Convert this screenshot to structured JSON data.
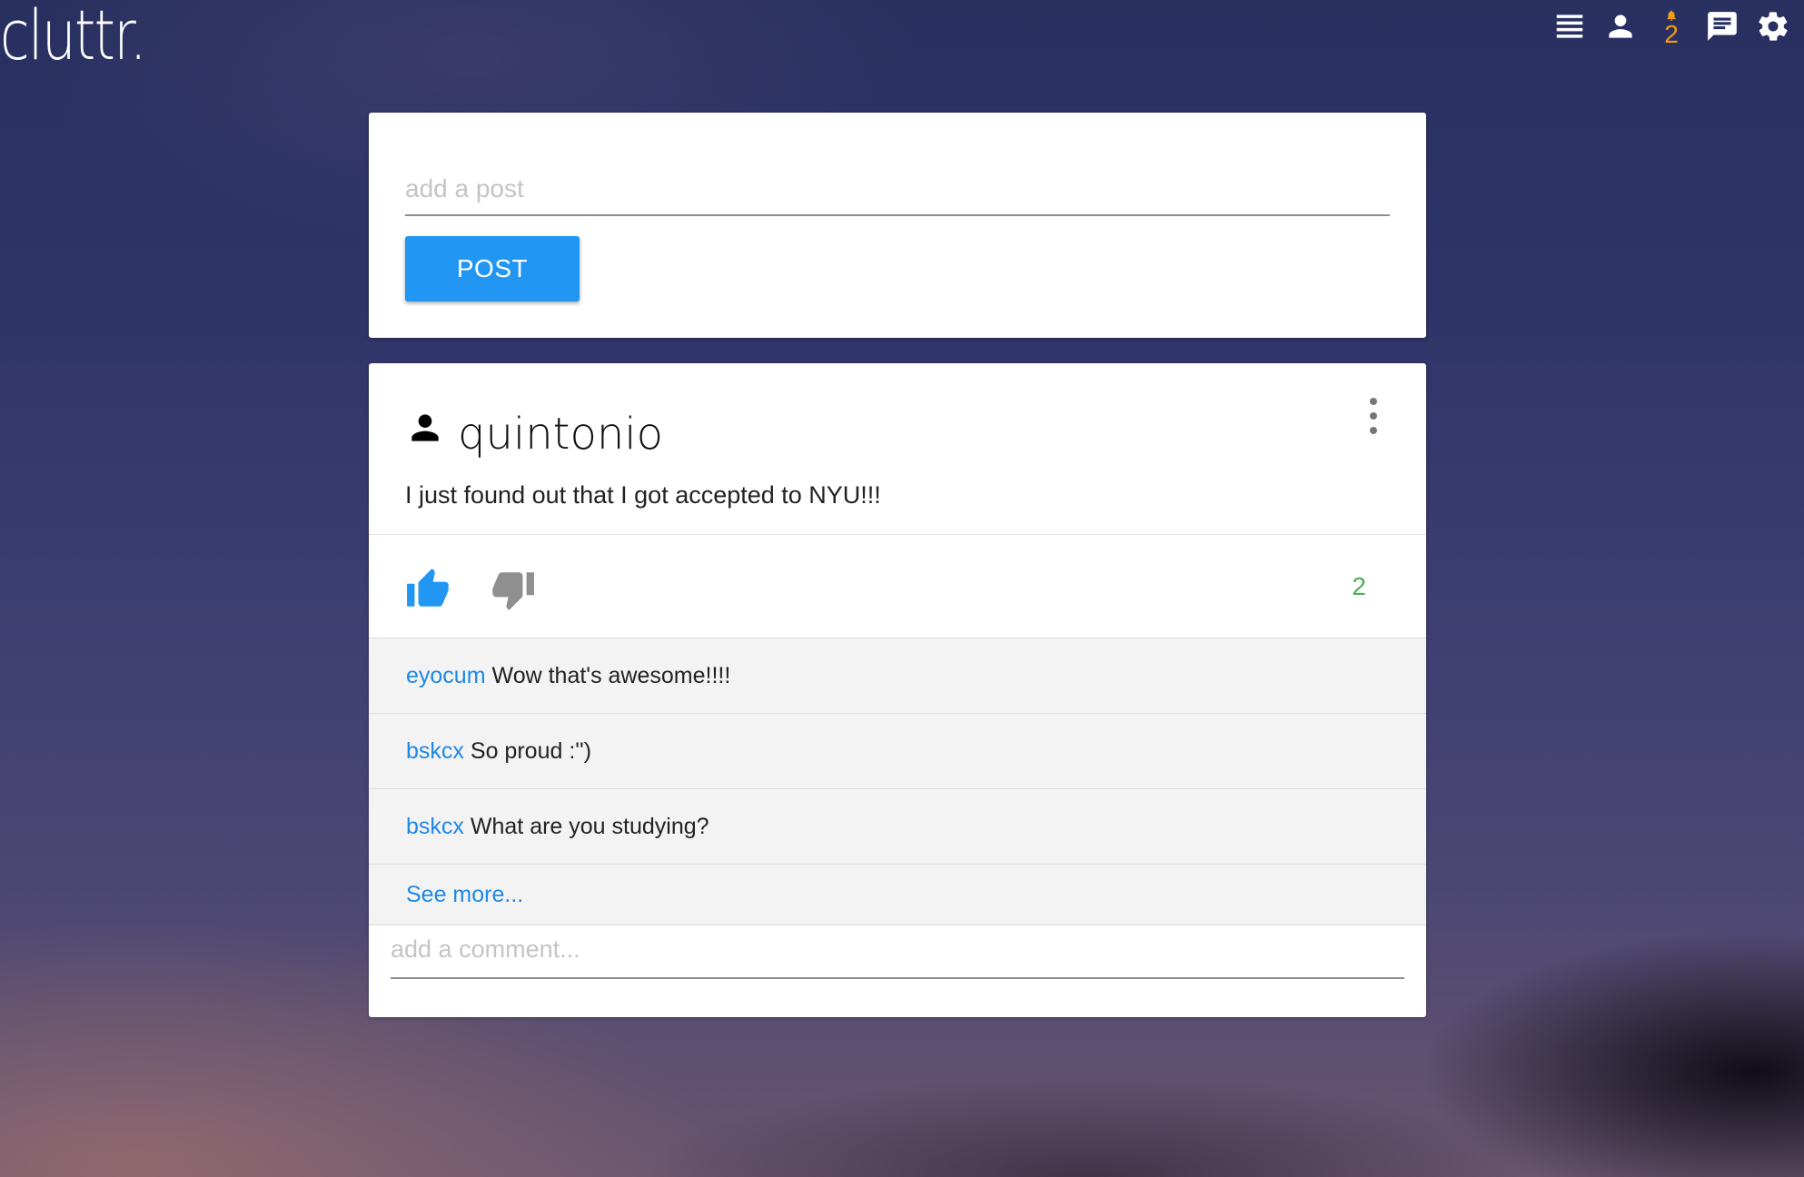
{
  "app": {
    "logo": "cluttr."
  },
  "nav": {
    "items": [
      {
        "icon": "list-icon"
      },
      {
        "icon": "profile-icon"
      },
      {
        "icon": "notifications-bell-icon",
        "badge": "2",
        "color": "#f39c12"
      },
      {
        "icon": "chat-icon"
      },
      {
        "icon": "settings-gear-icon"
      }
    ]
  },
  "composer": {
    "placeholder": "add a post",
    "button_label": "POST"
  },
  "post": {
    "author": "quintonio",
    "text": "I just found out that I got accepted to NYU!!!",
    "score": "2",
    "score_color": "#4caf50",
    "upvote_color": "#2196f3",
    "comments": [
      {
        "user": "eyocum",
        "text": "Wow that's awesome!!!!"
      },
      {
        "user": "bskcx",
        "text": "So proud :'')"
      },
      {
        "user": "bskcx",
        "text": "What are you studying?"
      }
    ],
    "see_more": "See more...",
    "comment_placeholder": "add a comment..."
  }
}
